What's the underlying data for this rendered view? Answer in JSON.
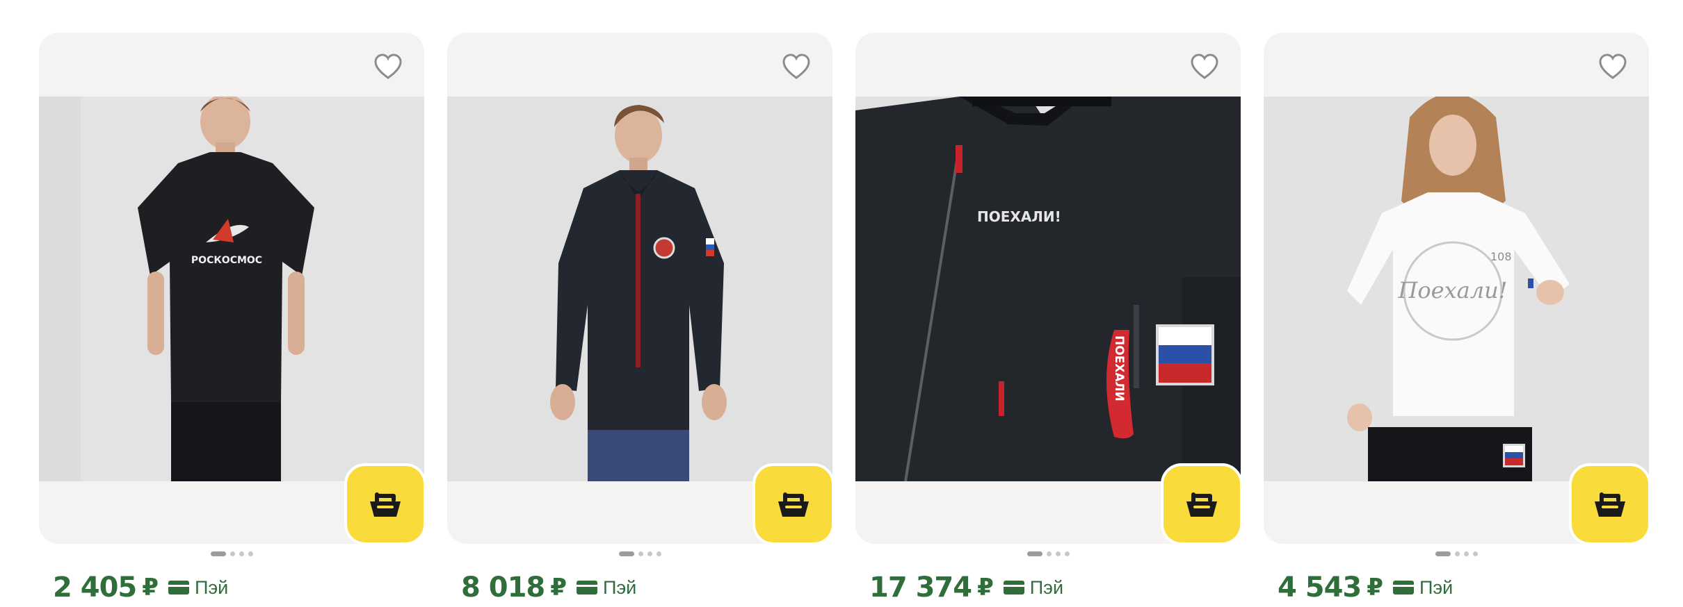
{
  "products": [
    {
      "price": "2 405",
      "currency": "₽",
      "pay_label": "Пэй",
      "print_text": "РОСКОСМОС",
      "favorite_icon": "heart-icon",
      "cart_icon": "basket-icon",
      "active_slide": 1,
      "slides": 4
    },
    {
      "price": "8 018",
      "currency": "₽",
      "pay_label": "Пэй",
      "favorite_icon": "heart-icon",
      "cart_icon": "basket-icon",
      "active_slide": 1,
      "slides": 4
    },
    {
      "price": "17 374",
      "currency": "₽",
      "pay_label": "Пэй",
      "print_text": "ПОЕХАЛИ!",
      "strap_text": "ПОЕХАЛИ",
      "favorite_icon": "heart-icon",
      "cart_icon": "basket-icon",
      "active_slide": 1,
      "slides": 4
    },
    {
      "price": "4 543",
      "currency": "₽",
      "pay_label": "Пэй",
      "print_text": "Поехали!",
      "print_number": "108",
      "favorite_icon": "heart-icon",
      "cart_icon": "basket-icon",
      "active_slide": 1,
      "slides": 4
    }
  ],
  "colors": {
    "accent_green": "#2f6e3b",
    "cart_yellow": "#f9dc3b",
    "card_bg": "#f4f3f2"
  }
}
